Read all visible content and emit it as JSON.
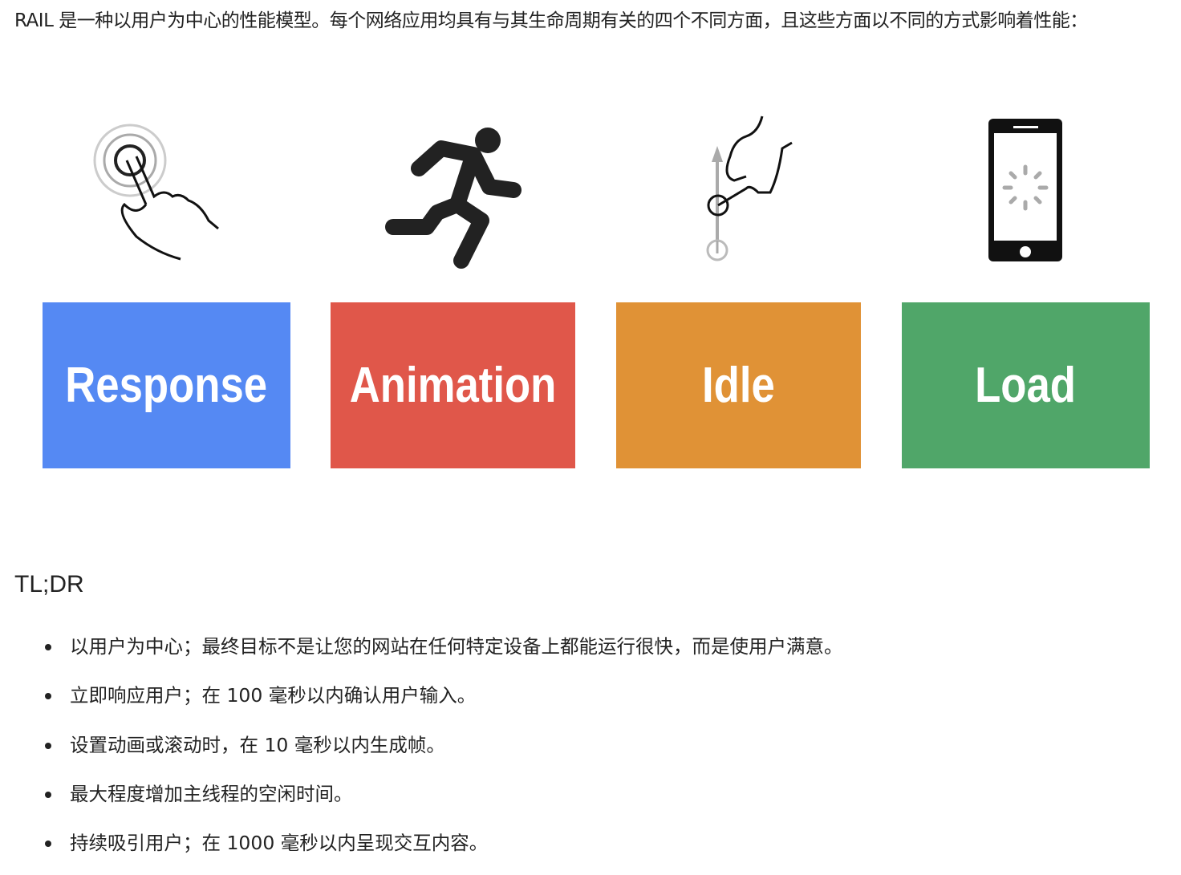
{
  "intro": "RAIL 是一种以用户为中心的性能模型。每个网络应用均具有与其生命周期有关的四个不同方面，且这些方面以不同的方式影响着性能：",
  "rail": [
    {
      "label": "Response",
      "color": "#5589f3",
      "icon": "tap-hand-icon"
    },
    {
      "label": "Animation",
      "color": "#e0574a",
      "icon": "running-person-icon"
    },
    {
      "label": "Idle",
      "color": "#e09236",
      "icon": "swipe-hand-icon"
    },
    {
      "label": "Load",
      "color": "#50a669",
      "icon": "phone-loading-icon"
    }
  ],
  "tldr_heading": "TL;DR",
  "bullets": [
    "以用户为中心；最终目标不是让您的网站在任何特定设备上都能运行很快，而是使用户满意。",
    "立即响应用户；在 100 毫秒以内确认用户输入。",
    "设置动画或滚动时，在 10 毫秒以内生成帧。",
    "最大程度增加主线程的空闲时间。",
    "持续吸引用户；在 1000 毫秒以内呈现交互内容。"
  ]
}
